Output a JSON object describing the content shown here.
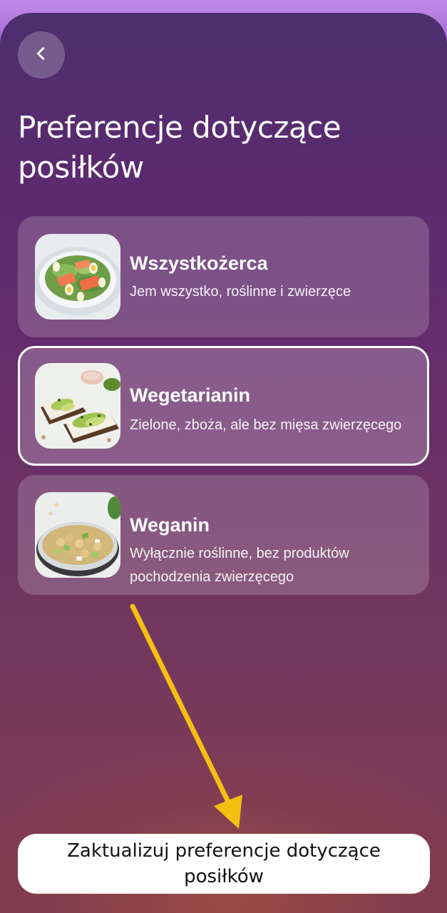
{
  "header": {
    "title": "Preferencje dotyczące posiłków"
  },
  "options": [
    {
      "title": "Wszystkożerca",
      "description": "Jem wszystko, roślinne i zwierzęce",
      "image": "salmon-salad",
      "selected": false
    },
    {
      "title": "Wegetarianin",
      "description": "Zielone, zboża, ale bez mięsa zwierzęcego",
      "image": "avocado-toast",
      "selected": true
    },
    {
      "title": "Weganin",
      "description": "Wyłącznie roślinne, bez produktów pochodzenia zwierzęcego",
      "image": "chickpea-salad",
      "selected": false
    }
  ],
  "update_button": {
    "label": "Zaktualizuj preferencje dotyczące posiłków"
  },
  "icons": {
    "back": "chevron-left-icon",
    "annotation": "yellow-arrow"
  },
  "colors": {
    "arrow": "#f5bf12",
    "selected_border": "#ffffff",
    "button_bg": "#ffffff"
  }
}
